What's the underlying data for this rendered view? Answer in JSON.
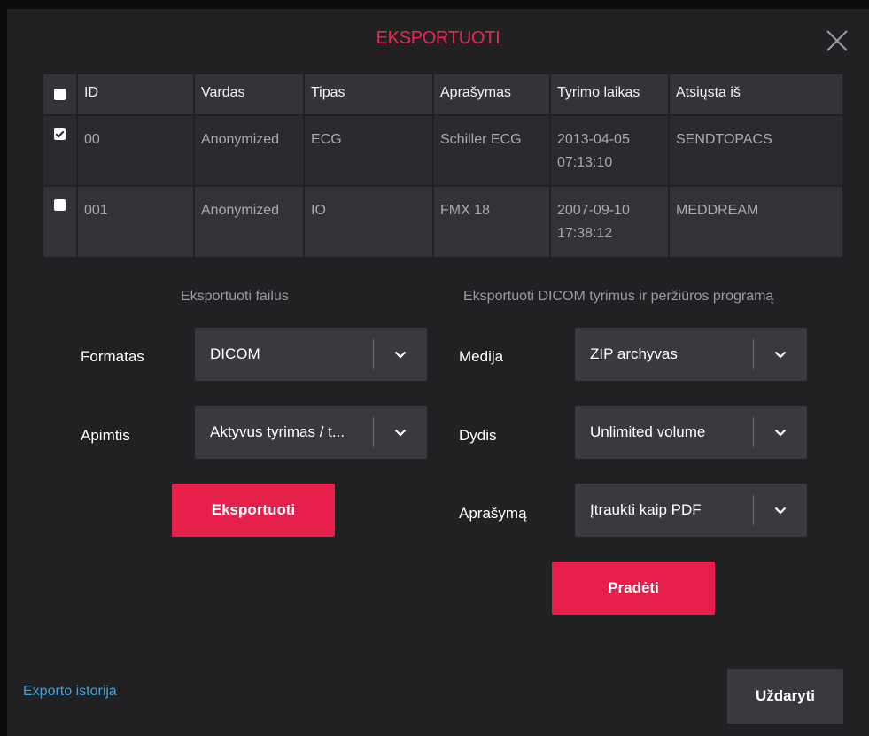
{
  "dialog": {
    "title": "EKSPORTUOTI",
    "close_icon": "close-icon"
  },
  "table": {
    "headers": [
      "ID",
      "Vardas",
      "Tipas",
      "Aprašymas",
      "Tyrimo laikas",
      "Atsiųsta iš"
    ],
    "select_all_checked": false,
    "rows": [
      {
        "checked": true,
        "id": "00",
        "vardas": "Anonymized",
        "tipas": "ECG",
        "aprasymas": "Schiller ECG",
        "laikas_date": "2013-04-05",
        "laikas_time": "07:13:10",
        "atsiusta": "SENDTOPACS"
      },
      {
        "checked": false,
        "id": "001",
        "vardas": "Anonymized",
        "tipas": "IO",
        "aprasymas": "FMX 18",
        "laikas_date": "2007-09-10",
        "laikas_time": "17:38:12",
        "atsiusta": "MEDDREAM"
      }
    ]
  },
  "export_files": {
    "section_label": "Eksportuoti failus",
    "format_label": "Formatas",
    "format_value": "DICOM",
    "scope_label": "Apimtis",
    "scope_value": "Aktyvus tyrimas / t...",
    "export_button": "Eksportuoti"
  },
  "export_dicom": {
    "section_label": "Eksportuoti DICOM tyrimus ir peržiūros programą",
    "media_label": "Medija",
    "media_value": "ZIP archyvas",
    "size_label": "Dydis",
    "size_value": "Unlimited volume",
    "description_label": "Aprašymą",
    "description_value": "Įtraukti kaip PDF",
    "start_button": "Pradėti"
  },
  "footer": {
    "history_link": "Exporto istorija",
    "close_button": "Uždaryti"
  },
  "colors": {
    "accent": "#e61f4b",
    "link": "#3aa3df",
    "dialog_bg": "#212023"
  }
}
